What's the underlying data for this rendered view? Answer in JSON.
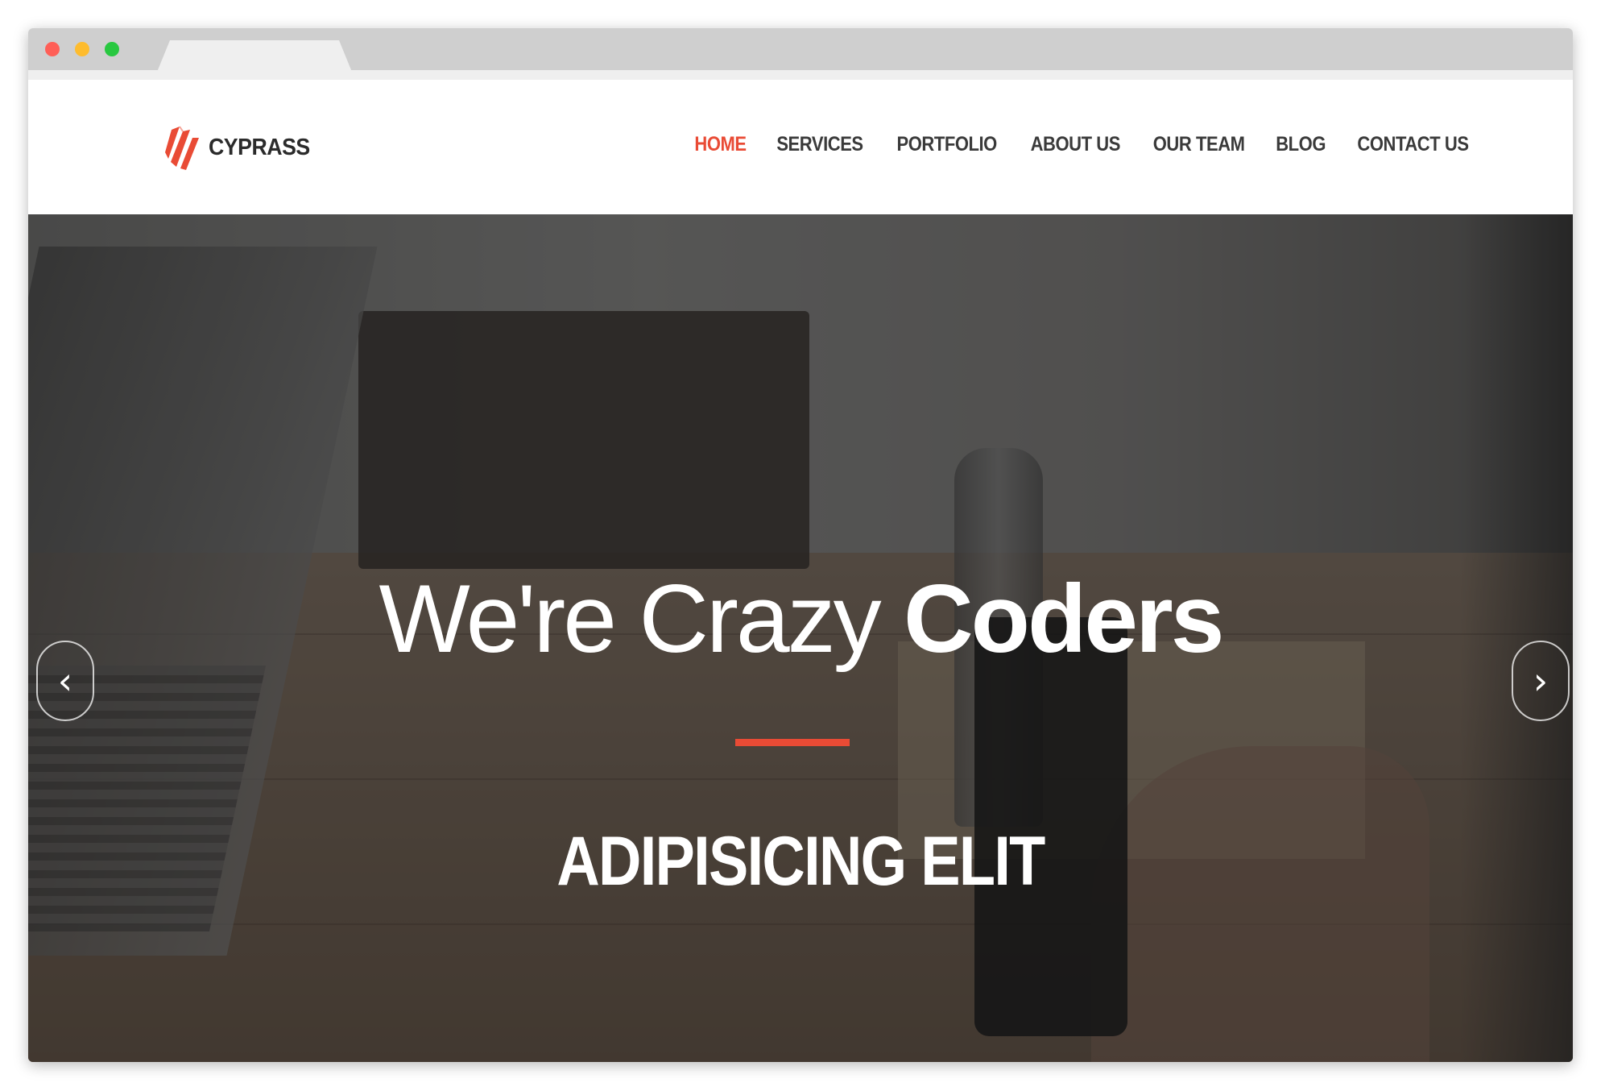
{
  "header": {
    "logo_text": "CYPRASS",
    "nav": [
      {
        "label": "HOME",
        "active": true
      },
      {
        "label": "SERVICES",
        "active": false
      },
      {
        "label": "PORTFOLIO",
        "active": false
      },
      {
        "label": "ABOUT US",
        "active": false
      },
      {
        "label": "OUR TEAM",
        "active": false
      },
      {
        "label": "BLOG",
        "active": false
      },
      {
        "label": "CONTACT US",
        "active": false
      }
    ]
  },
  "hero": {
    "title_light": "We're Crazy ",
    "title_bold": "Coders",
    "subtitle": "ADIPISICING ELIT",
    "prev_icon": "‹",
    "next_icon": "›"
  },
  "colors": {
    "accent": "#e94b35",
    "nav_text": "#3a3a3a",
    "logo_text": "#2b2b2b"
  },
  "icons": {
    "logo": "cyprass-logo-icon",
    "prev": "chevron-left-icon",
    "next": "chevron-right-icon"
  }
}
